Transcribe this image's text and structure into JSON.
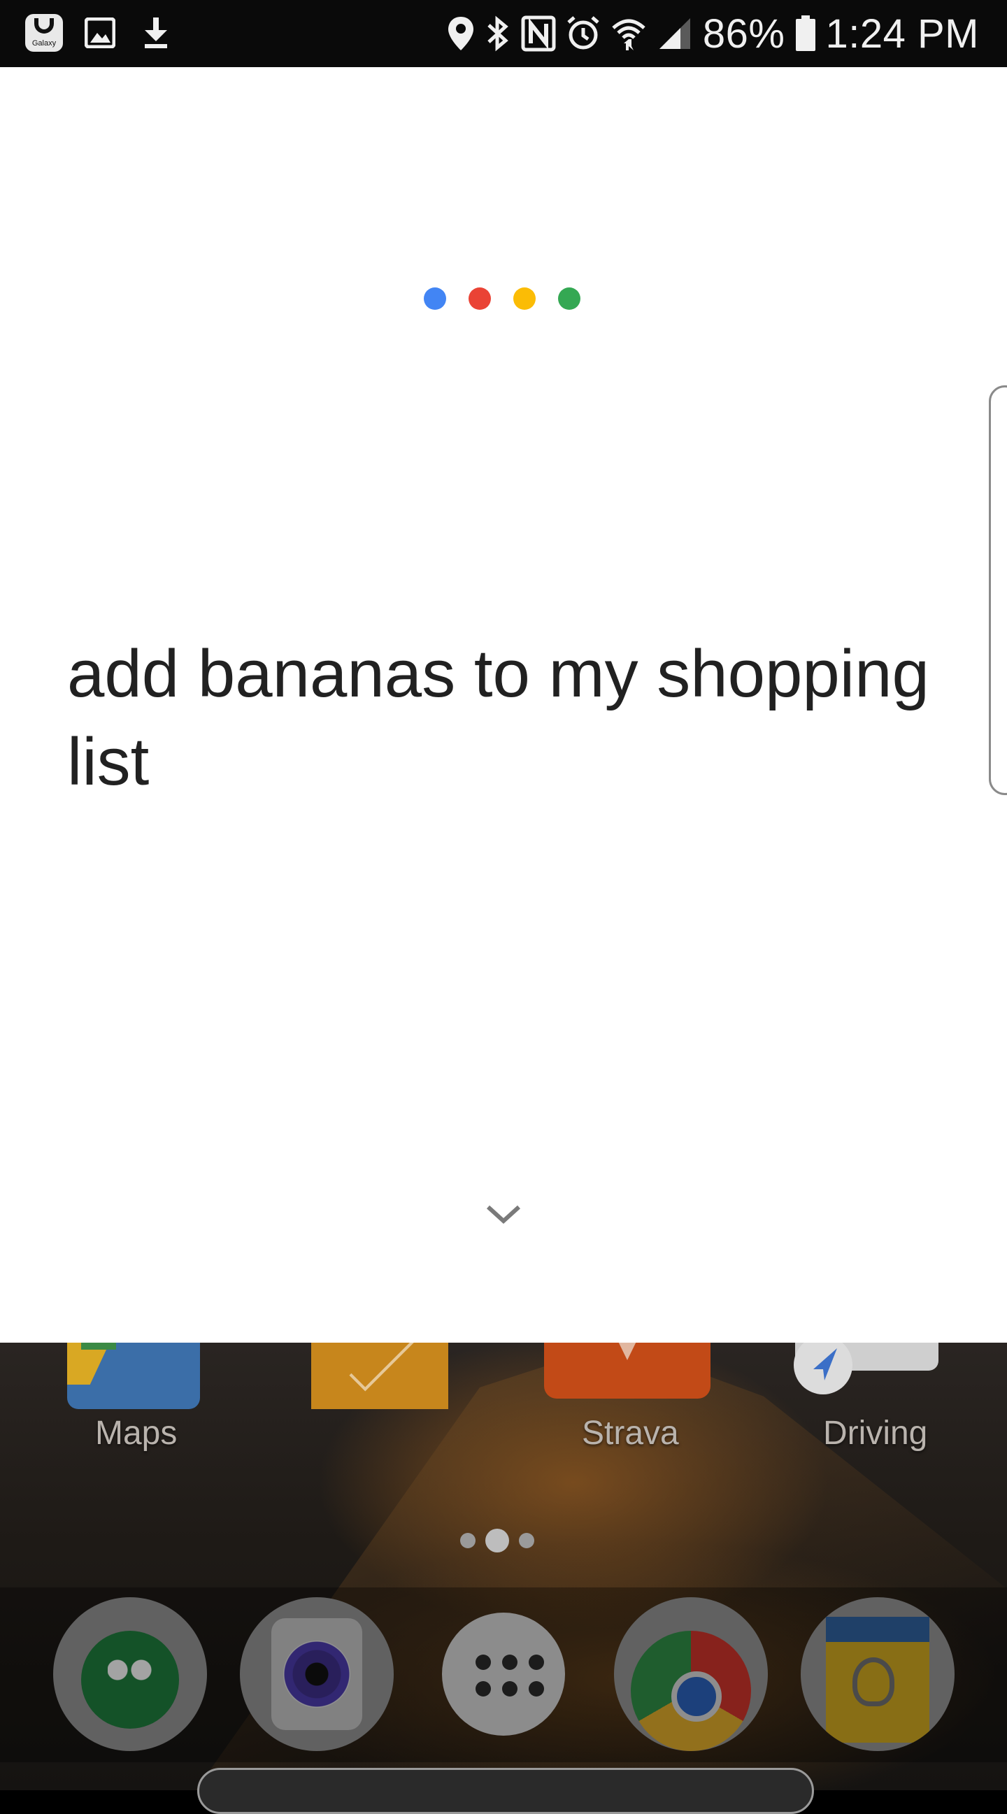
{
  "status_bar": {
    "notification_icons": [
      "galaxy-store-icon",
      "gallery-icon",
      "download-icon"
    ],
    "galaxy_badge_text": "Galaxy",
    "system_icons": [
      "location-icon",
      "bluetooth-icon",
      "nfc-icon",
      "alarm-icon",
      "wifi-icon",
      "signal-icon",
      "battery-icon"
    ],
    "battery": "86%",
    "time": "1:24 PM"
  },
  "assistant": {
    "dot_colors": [
      "#4285F4",
      "#EA4335",
      "#FBBC05",
      "#34A853"
    ],
    "query_text": "add bananas to my shopping list",
    "collapse_icon": "chevron-down-icon"
  },
  "home": {
    "apps": [
      {
        "name": "Maps"
      },
      {
        "name": ""
      },
      {
        "name": "Strava"
      },
      {
        "name": "Driving"
      }
    ],
    "page_indicator": {
      "count": 3,
      "active": 1
    },
    "dock": [
      "Hangouts",
      "Camera",
      "Apps",
      "Chrome",
      "Keep"
    ]
  }
}
